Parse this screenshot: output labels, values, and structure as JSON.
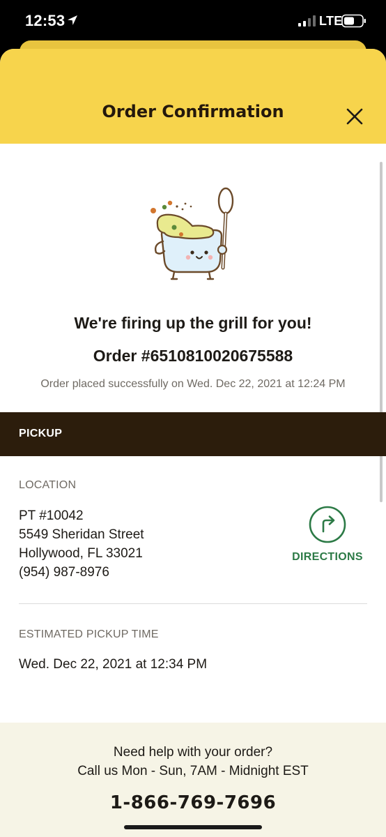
{
  "status_bar": {
    "time": "12:53",
    "network": "LTE"
  },
  "sheet": {
    "title": "Order Confirmation"
  },
  "confirmation": {
    "headline": "We're firing up the grill for you!",
    "order_number": "Order #6510810020675588",
    "placed_text": "Order placed successfully on Wed. Dec 22, 2021 at 12:24 PM"
  },
  "pickup": {
    "banner_label": "PICKUP",
    "location_label": "LOCATION",
    "address_lines": [
      "PT #10042",
      "5549 Sheridan Street",
      "Hollywood, FL 33021",
      "(954) 987-8976"
    ],
    "directions_label": "DIRECTIONS",
    "pickup_time_label": "ESTIMATED PICKUP TIME",
    "pickup_time": "Wed. Dec 22, 2021 at 12:34 PM"
  },
  "help": {
    "line1": "Need help with your order?",
    "line2": "Call us Mon - Sun, 7AM - Midnight EST",
    "phone": "1-866-769-7696"
  },
  "colors": {
    "header_yellow": "#f7d44c",
    "banner_brown": "#2c1d0c",
    "accent_green": "#2c7a46",
    "footer_cream": "#f6f4e6"
  },
  "icons": [
    "location-arrow-icon",
    "signal-icon",
    "battery-icon",
    "close-icon",
    "soup-pot-mascot",
    "directions-arrow-icon"
  ]
}
